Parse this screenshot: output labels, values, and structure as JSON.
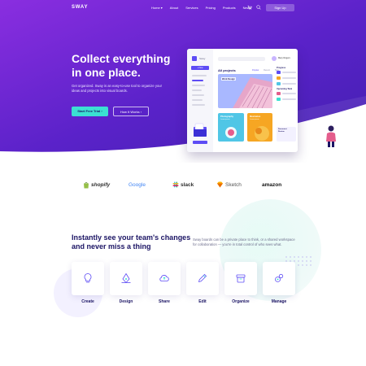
{
  "nav": {
    "logo": "SWAY",
    "items": [
      "Home ▾",
      "About",
      "Services",
      "Pricing",
      "Products",
      "News"
    ],
    "cart_icon": "cart-icon",
    "search_icon": "search-icon",
    "signup_label": "Sign Up"
  },
  "hero": {
    "title": "Collect everything in one place.",
    "subtitle": "Get organized. Sway is an easy-to-use tool to organize your ideas and projects into visual boards.",
    "primary_cta": "Start Free Trial  ›",
    "secondary_cta": "How It Works  ›"
  },
  "mock": {
    "brand": "Sway",
    "new_button": "+ New",
    "user_name": "Mary Rogers",
    "section_title": "All projects",
    "tabs": [
      "Popular",
      "Recent",
      "Tags"
    ],
    "main_card_label": "Work Design",
    "card_a_title": "Photography",
    "card_a_sub": "Lorem ipsum",
    "card_b_title": "Illustration",
    "card_b_sub": "Lorem ipsum",
    "right_title_1": "Progress",
    "right_title_2": "Upcoming Task",
    "right_card": "Document Review"
  },
  "brands": [
    "shopify",
    "Google",
    "slack",
    "Sketch",
    "amazon"
  ],
  "features": {
    "title": "Instantly see your team's changes and never miss a thing",
    "description": "Sway boards can be a private place to think, or a shared workspace for collaboration — you're in total control of who sees what.",
    "items": [
      {
        "label": "Create",
        "icon": "lightbulb-icon"
      },
      {
        "label": "Design",
        "icon": "pen-tool-icon"
      },
      {
        "label": "Share",
        "icon": "cloud-share-icon"
      },
      {
        "label": "Edit",
        "icon": "pencil-icon"
      },
      {
        "label": "Organize",
        "icon": "archive-icon"
      },
      {
        "label": "Manage",
        "icon": "settings-icon"
      }
    ]
  },
  "colors": {
    "hero_gradient_start": "#7b2bdc",
    "hero_gradient_end": "#4a1fb8",
    "accent_teal": "#3be0d2",
    "heading_navy": "#1b1464",
    "primary_purple": "#5d4cf5"
  }
}
